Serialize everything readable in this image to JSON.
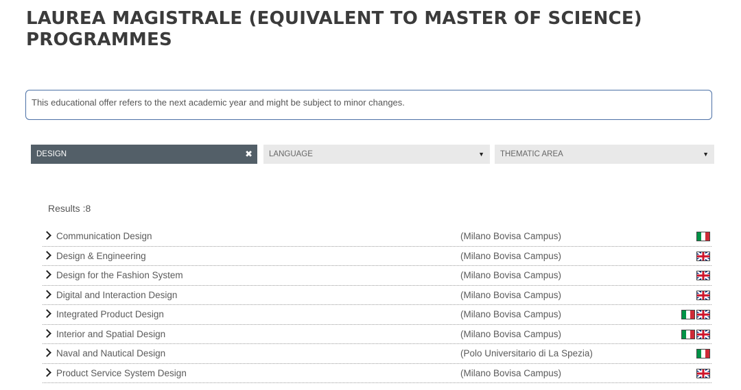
{
  "page_title": "LAUREA MAGISTRALE (EQUIVALENT TO MASTER OF SCIENCE) PROGRAMMES",
  "notice": "This educational offer refers to the next academic year and might be subject to minor changes.",
  "filters": {
    "school": {
      "value": "DESIGN",
      "icon": "clear-icon"
    },
    "language": {
      "placeholder": "LANGUAGE",
      "icon": "caret-down-icon"
    },
    "thematic_area": {
      "placeholder": "THEMATIC AREA",
      "icon": "caret-down-icon"
    }
  },
  "results_label": "Results :8",
  "colors": {
    "accent_border": "#4a6fa5",
    "active_filter_bg": "#535f68",
    "inactive_filter_bg": "#e9e9e9"
  },
  "programs": [
    {
      "name": "Communication Design",
      "campus": "(Milano Bovisa Campus)",
      "languages": [
        "it"
      ]
    },
    {
      "name": "Design & Engineering",
      "campus": "(Milano Bovisa Campus)",
      "languages": [
        "uk"
      ]
    },
    {
      "name": "Design for the Fashion System",
      "campus": "(Milano Bovisa Campus)",
      "languages": [
        "uk"
      ]
    },
    {
      "name": "Digital and Interaction Design",
      "campus": "(Milano Bovisa Campus)",
      "languages": [
        "uk"
      ]
    },
    {
      "name": "Integrated Product Design",
      "campus": "(Milano Bovisa Campus)",
      "languages": [
        "it",
        "uk"
      ]
    },
    {
      "name": "Interior and Spatial Design",
      "campus": "(Milano Bovisa Campus)",
      "languages": [
        "it",
        "uk"
      ]
    },
    {
      "name": "Naval and Nautical Design",
      "campus": "(Polo Universitario di La Spezia)",
      "languages": [
        "it"
      ]
    },
    {
      "name": "Product Service System Design",
      "campus": "(Milano Bovisa Campus)",
      "languages": [
        "uk"
      ]
    }
  ]
}
